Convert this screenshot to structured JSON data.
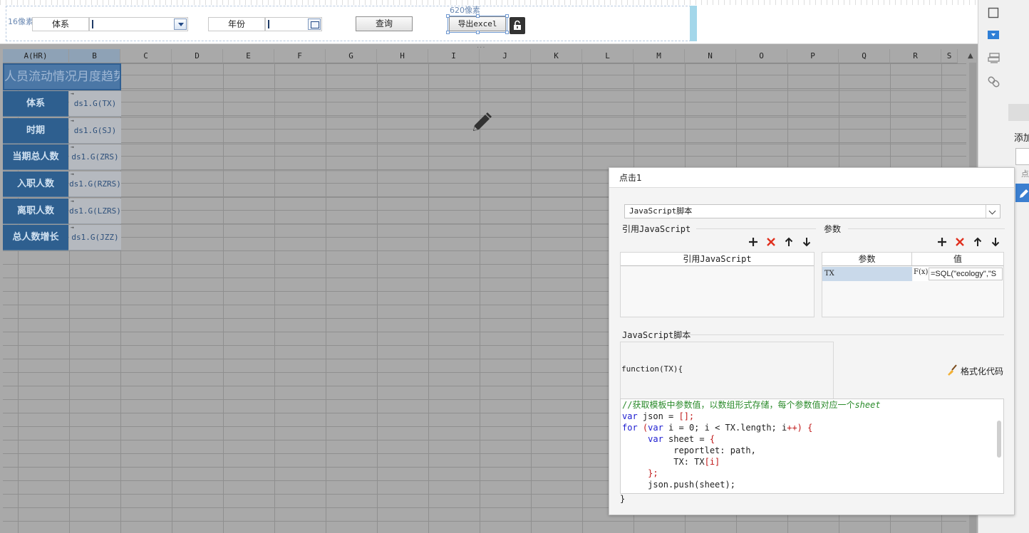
{
  "param_pane": {
    "guide_left": "16像素",
    "guide_top": "620像素",
    "system_label": "体系",
    "year_label": "年份",
    "query_button": "查询",
    "export_button": "导出excel",
    "more_handle": "..."
  },
  "sheet": {
    "columns": [
      "A(HR)",
      "B",
      "C",
      "D",
      "E",
      "F",
      "G",
      "H",
      "I",
      "J",
      "K",
      "L",
      "M",
      "N",
      "O",
      "P",
      "Q",
      "R",
      "S"
    ],
    "title": "人员流动情况月度趋势",
    "rows": [
      {
        "label": "体系",
        "value": "ds1.G(TX)"
      },
      {
        "label": "时期",
        "value": "ds1.G(SJ)"
      },
      {
        "label": "当期总人数",
        "value": "ds1.G(ZRS)"
      },
      {
        "label": "入职人数",
        "value": "ds1.G(RZRS)"
      },
      {
        "label": "离职人数",
        "value": "ds1.G(LZRS)"
      },
      {
        "label": "总人数增长",
        "value": "ds1.G(JZZ)"
      }
    ],
    "expand_marker": "→"
  },
  "right_bar": {
    "add_label": "添加",
    "item2": "点"
  },
  "dialog": {
    "title": "点击1",
    "type_value": "JavaScript脚本",
    "ref_js_section": "引用JavaScript",
    "params_section": "参数",
    "ref_js_header": "引用JavaScript",
    "param_col": "参数",
    "value_col": "值",
    "param_row": {
      "name": "TX",
      "fx": "F(x)",
      "value": "=SQL(\"ecology\",\"S"
    },
    "script_section": "JavaScript脚本",
    "fn_signature": "function(TX){",
    "format_button": "格式化代码",
    "code": {
      "l1_comment": "//获取模板中参数值，以数组形式存储，每个参数值对应一个",
      "l1_italic": "sheet",
      "l2_kw": "var",
      "l2_rest": " json = ",
      "l2_red": "[];",
      "l3_kw1": "for",
      "l3_a": " (",
      "l3_kw2": "var",
      "l3_b": " i = 0; i < TX.length; i",
      "l3_red": "++) {",
      "l4_pad": "     ",
      "l4_kw": "var",
      "l4_rest": " sheet = ",
      "l4_red": "{",
      "l5": "          reportlet: path,",
      "l6_a": "          TX: TX",
      "l6_red": "[i]",
      "l7_pad": "     ",
      "l7_red": "};",
      "l8": "     json.push(sheet);"
    },
    "close_brace": "}"
  }
}
